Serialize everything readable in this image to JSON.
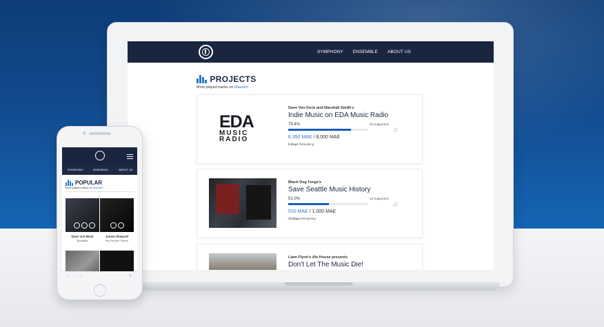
{
  "colors": {
    "nav_bg": "#1a2640",
    "accent": "#2b78c8",
    "progress": "#1a5db5"
  },
  "desktop": {
    "nav": {
      "items": [
        "SYMPHONY",
        "ENSEMBLE",
        "ABOUT US"
      ]
    },
    "section": {
      "title": "PROJECTS",
      "subtitle_prefix": "Most played tracks on",
      "subtitle_link": "Maestro"
    },
    "projects": [
      {
        "by": "Dave Von Deck and Marshall Smith's",
        "title": "Indie Music on EDA Music Radio",
        "percent": "79.4%",
        "progress": 79.4,
        "supporters": "35 Supporters",
        "raised": "6,350 MAE",
        "goal": "/ 8,000 MAE",
        "days": "5 Days",
        "days_label": "Remaining",
        "logo_big": "EDA",
        "logo_small_1": "MUSIC",
        "logo_small_2": "RADIO"
      },
      {
        "by": "Black Dog Forge's",
        "title": "Save Seattle Music History",
        "percent": "51.0%",
        "progress": 51.0,
        "supporters": "15 Supporters",
        "raised": "510 MAE",
        "goal": "/ 1,000 MAE",
        "days": "13 Days",
        "days_label": "Remaining"
      },
      {
        "by": "Liam Flynn's Ale House presents",
        "title": "Don't Let The Music Die!"
      }
    ]
  },
  "mobile": {
    "subnav": [
      "SYMPHONY",
      "ENSEMBLE",
      "ABOUT US"
    ],
    "section": {
      "title": "POPULAR",
      "subtitle_prefix": "Most played tracks on",
      "subtitle_link": "Maestro"
    },
    "tracks": [
      {
        "artist": "Dave von Beck",
        "song": "Beautiful"
      },
      {
        "artist": "James Shepard",
        "song": "My Forever Friend"
      }
    ],
    "bottom_icons": [
      "back-arrow-icon",
      "forward-arrow-icon",
      "share-icon"
    ]
  }
}
